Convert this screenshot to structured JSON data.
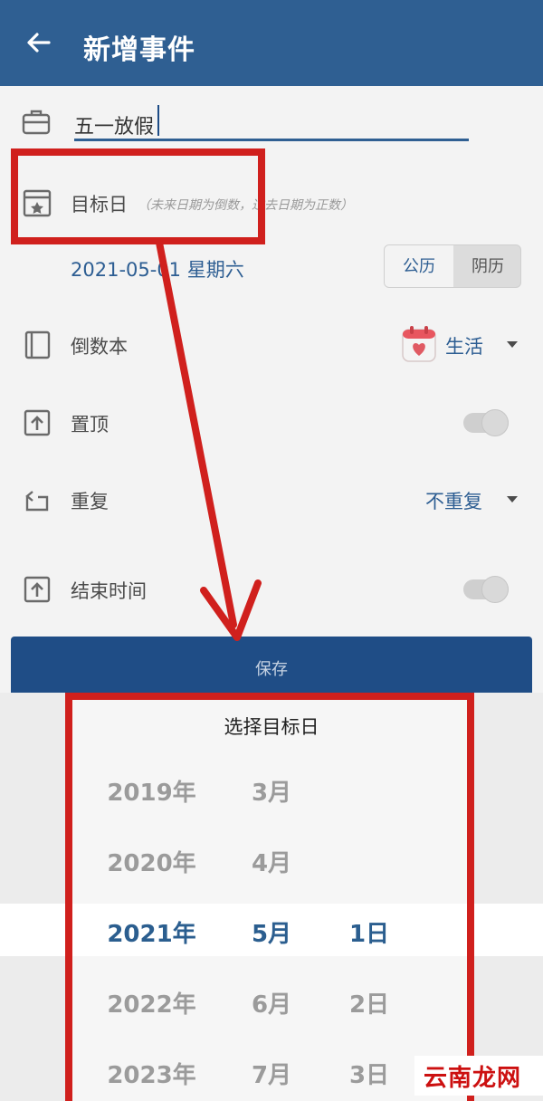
{
  "appbar": {
    "title": "新增事件",
    "back_icon": "back-arrow-icon"
  },
  "form": {
    "event_name_value": "五一放假",
    "target_date": {
      "label": "目标日",
      "hint": "（未来日期为倒数，过去日期为正数）",
      "value": "2021-05-01 星期六",
      "calendar_options": [
        "公历",
        "阴历"
      ],
      "selected_calendar": "公历"
    },
    "countdown_book": {
      "label": "倒数本",
      "value": "生活"
    },
    "pin_top": {
      "label": "置顶",
      "on": false
    },
    "repeat": {
      "label": "重复",
      "value": "不重复"
    },
    "end_time": {
      "label": "结束时间",
      "on": false
    },
    "save_label": "保存"
  },
  "picker": {
    "title": "选择目标日",
    "years": [
      "2019年",
      "2020年",
      "2021年",
      "2022年",
      "2023年"
    ],
    "months": [
      "3月",
      "4月",
      "5月",
      "6月",
      "7月"
    ],
    "days": [
      "",
      "",
      "1日",
      "2日",
      "3日"
    ],
    "selected_index": 2
  },
  "watermark": "云南龙网",
  "colors": {
    "primary": "#2f5f92",
    "annotation_red": "#d0201d",
    "selected": "#2b5e8f"
  }
}
